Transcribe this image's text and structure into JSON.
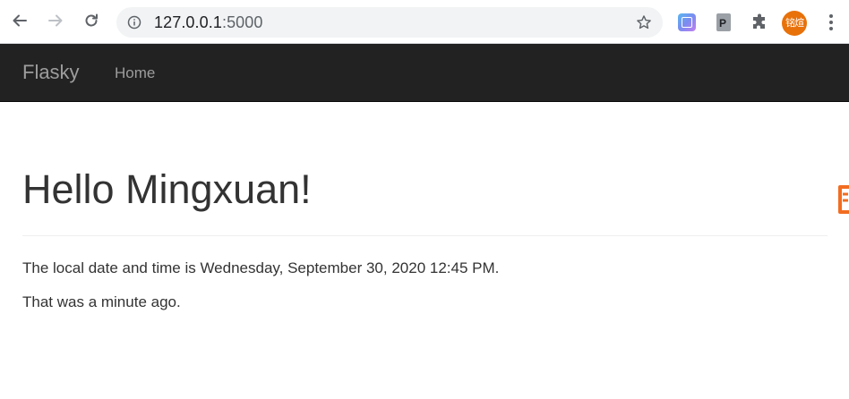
{
  "browser": {
    "url_host": "127.0.0.1",
    "url_port": ":5000",
    "avatar_text": "铭煊",
    "icons": {
      "back": "arrow-left-icon",
      "forward": "arrow-right-icon",
      "reload": "reload-icon",
      "site_info": "info-icon",
      "bookmark": "star-icon",
      "extension_translate": "translate-extension-icon",
      "extension_p": "p-extension-icon",
      "extensions_menu": "puzzle-icon",
      "menu": "kebab-menu-icon"
    },
    "colors": {
      "avatar_bg": "#e8710a",
      "omnibox_bg": "#f1f3f4"
    }
  },
  "navbar": {
    "brand": "Flasky",
    "links": [
      {
        "label": "Home"
      }
    ],
    "colors": {
      "background": "#222222",
      "text": "#9d9d9d"
    }
  },
  "main": {
    "heading": "Hello Mingxuan!",
    "datetime_text": "The local date and time is Wednesday, September 30, 2020 12:45 PM.",
    "relative_text": "That was a minute ago."
  }
}
